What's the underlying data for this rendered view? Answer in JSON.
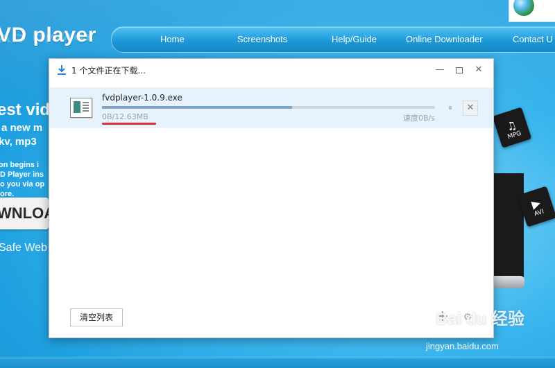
{
  "site": {
    "logo": "VD player",
    "nav": [
      "Home",
      "Screenshots",
      "Help/Guide",
      "Online Downloader",
      "Contact U"
    ],
    "hero": {
      "line1": "est vide",
      "line2": "a new m",
      "line3": "kv, mp3",
      "small1": "on begins i",
      "small2": "D Player ins",
      "small3": "o you via op",
      "small4": "ore.",
      "download": "WNLOA",
      "safe": "Safe Web"
    },
    "media_icons": [
      "MPG",
      "AVI"
    ]
  },
  "dialog": {
    "title": "1 个文件正在下载...",
    "item": {
      "filename": "fvdplayer-1.0.9.exe",
      "size_text": "0B/12.63MB",
      "speed_text": "速度0B/s",
      "progress": 0.57
    },
    "clear_label": "清空列表",
    "icons": {
      "title": "download-icon",
      "minimize": "minimize-icon",
      "maximize": "maximize-icon",
      "close": "close-icon",
      "pause": "pause-icon",
      "cancel": "cancel-icon",
      "add": "plus-icon",
      "settings": "settings-icon"
    }
  },
  "watermark": {
    "brand": "Bai du 经验",
    "url": "jingyan.baidu.com"
  },
  "colors": {
    "site_bg": "#29a8e6",
    "row_highlight": "#e6f2fc",
    "progress_fill": "#7fa6c7",
    "annotation_underline": "#d9303b"
  }
}
